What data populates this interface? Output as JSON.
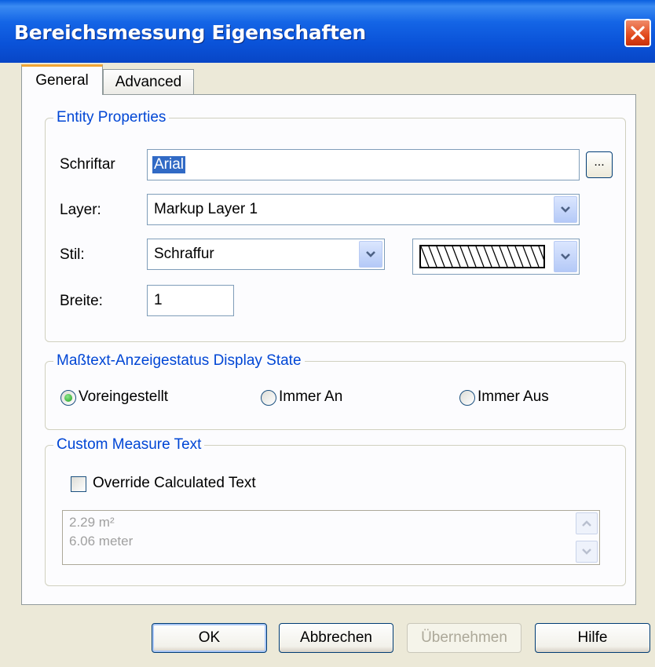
{
  "window": {
    "title": "Bereichsmessung Eigenschaften"
  },
  "tabs": [
    {
      "label": "General",
      "active": true
    },
    {
      "label": "Advanced",
      "active": false
    }
  ],
  "entity_properties": {
    "legend": "Entity Properties",
    "font": {
      "label": "Schriftar",
      "value": "Arial",
      "browse_label": "..."
    },
    "layer": {
      "label": "Layer:",
      "value": "Markup Layer 1"
    },
    "style": {
      "label": "Stil:",
      "value": "Schraffur",
      "pattern": "diagonal-hatch"
    },
    "width": {
      "label": "Breite:",
      "value": "1"
    }
  },
  "display_state": {
    "legend": "Maßtext-Anzeigestatus Display State",
    "options": [
      {
        "label": "Voreingestellt",
        "selected": true
      },
      {
        "label": "Immer An",
        "selected": false
      },
      {
        "label": "Immer Aus",
        "selected": false
      }
    ]
  },
  "custom_text": {
    "legend": "Custom Measure Text",
    "override_label": "Override Calculated Text",
    "override_checked": false,
    "lines": [
      "2.29 m²",
      "6.06 meter"
    ]
  },
  "buttons": {
    "ok": "OK",
    "cancel": "Abbrechen",
    "apply": "Übernehmen",
    "help": "Hilfe"
  },
  "colors": {
    "accent": "#0046d5",
    "selection": "#316ac5",
    "tab_highlight": "#f1a535",
    "close": "#e24a1d"
  }
}
